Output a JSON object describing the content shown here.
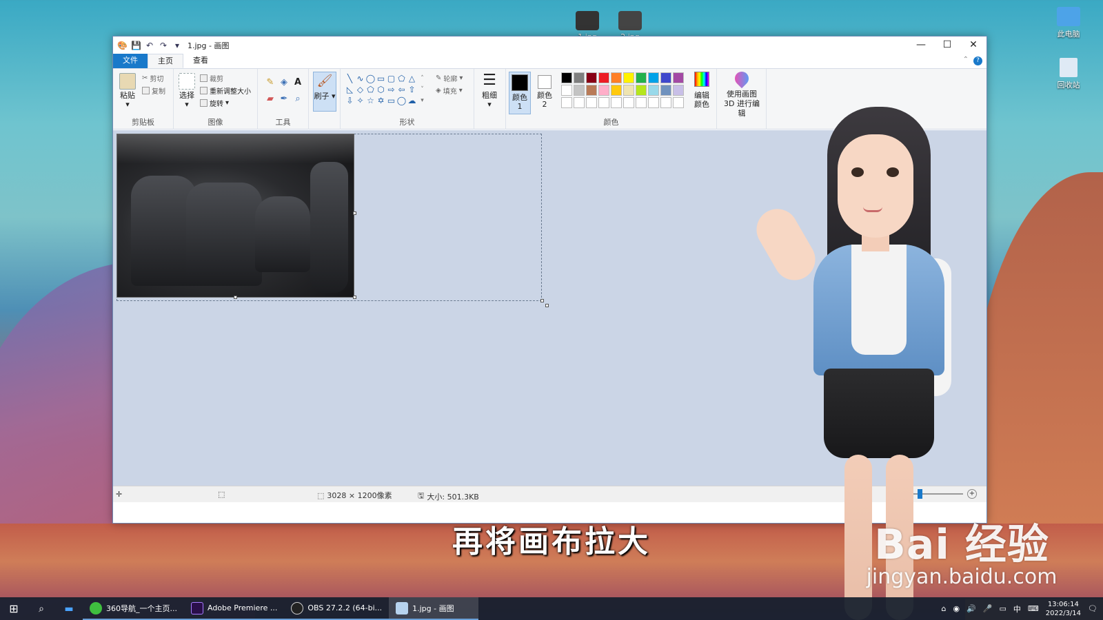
{
  "desktop": {
    "icons": [
      {
        "label": "1.jpg"
      },
      {
        "label": "2.jpg"
      },
      {
        "label": "此电脑"
      },
      {
        "label": "回收站"
      }
    ]
  },
  "window": {
    "title": "1.jpg - 画图",
    "controls": {
      "minimize": "—",
      "maximize": "☐",
      "close": "✕"
    }
  },
  "tabs": {
    "file": "文件",
    "home": "主页",
    "view": "查看"
  },
  "ribbon": {
    "clipboard": {
      "label": "剪贴板",
      "paste": "粘贴",
      "cut": "剪切",
      "copy": "复制"
    },
    "image": {
      "label": "图像",
      "select": "选择",
      "crop": "裁剪",
      "resize": "重新调整大小",
      "rotate": "旋转"
    },
    "tools": {
      "label": "工具"
    },
    "brushes": {
      "label": "刷子"
    },
    "shapes": {
      "label": "形状",
      "outline": "轮廓",
      "fill": "填充"
    },
    "size": {
      "label": "粗细"
    },
    "colors": {
      "label": "颜色",
      "color1": "颜色 1",
      "color2": "颜色 2",
      "edit": "编辑颜色",
      "palette": [
        "#000000",
        "#7f7f7f",
        "#880015",
        "#ed1c24",
        "#ff7f27",
        "#fff200",
        "#22b14c",
        "#00a2e8",
        "#3f48cc",
        "#a349a4",
        "#ffffff",
        "#c3c3c3",
        "#b97a57",
        "#ffaec9",
        "#ffc90e",
        "#efe4b0",
        "#b5e61d",
        "#99d9ea",
        "#7092be",
        "#c8bfe7",
        "#ffffff",
        "#ffffff",
        "#ffffff",
        "#ffffff",
        "#ffffff",
        "#ffffff",
        "#ffffff",
        "#ffffff",
        "#ffffff",
        "#ffffff"
      ]
    },
    "paint3d": {
      "label": "使用画图 3D 进行编辑"
    }
  },
  "statusbar": {
    "dimensions": "3028 × 1200像素",
    "size": "大小: 501.3KB"
  },
  "overlay": {
    "subtitle": "再将画布拉大",
    "watermark_logo": "Bai 经验",
    "watermark_url": "jingyan.baidu.com"
  },
  "taskbar": {
    "apps": [
      {
        "label": "360导航_一个主页..."
      },
      {
        "label": "Adobe Premiere ..."
      },
      {
        "label": "OBS 27.2.2 (64-bi..."
      },
      {
        "label": "1.jpg - 画图"
      }
    ],
    "ime": "中",
    "time": "13:06:14",
    "date": "2022/3/14"
  }
}
